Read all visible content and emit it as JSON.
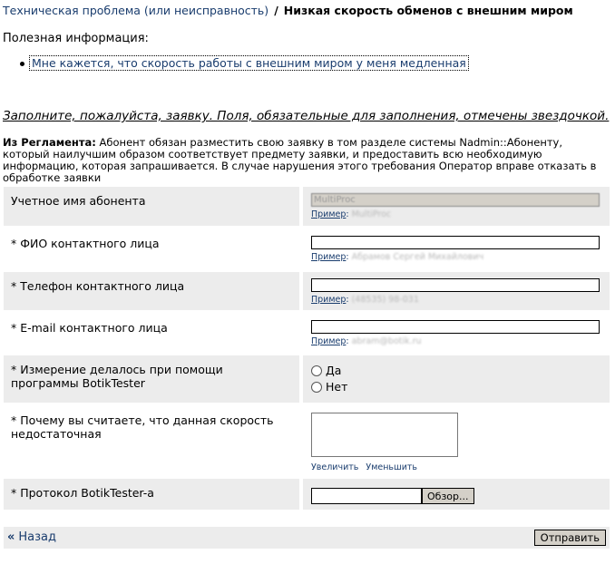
{
  "breadcrumb": {
    "parent": "Техническая проблема (или неисправность)",
    "separator": "/",
    "current": "Низкая скорость обменов с внешним миром"
  },
  "useful": {
    "heading": "Полезная информация:",
    "link": "Мне кажется, что скорость работы с внешним миром у меня медленная"
  },
  "request_note": "Заполните, пожалуйста, заявку. Поля, обязательные для заполнения, отмечены звездочкой.",
  "reglament": {
    "label": "Из Регламента:",
    "text": " Абонент обязан разместить свою заявку в том разделе системы Nadmin::Абоненту, который наилучшим образом соответствует предмету заявки, и предоставить всю необходимую информацию, которая запрашивается. В случае нарушения этого требования Оператор вправе отказать в обработке заявки"
  },
  "form": {
    "example_label": "Пример",
    "account": {
      "label": "Учетное имя абонента",
      "value": "MultiProc",
      "example": "MultiProc"
    },
    "fio": {
      "label": "* ФИО контактного лица",
      "value": "",
      "example": "Абрамов Сергей Михайлович"
    },
    "phone": {
      "label": "* Телефон контактного лица",
      "value": "",
      "example": "(48535) 98-031"
    },
    "email": {
      "label": "* E-mail контактного лица",
      "value": "",
      "example": "abram@botik.ru"
    },
    "botiktester": {
      "label": "* Измерение делалось при помощи программы BotikTester",
      "options": [
        "Да",
        "Нет"
      ]
    },
    "reason": {
      "label": "* Почему вы считаете, что данная скорость недостаточная",
      "value": "",
      "enlarge": "Увеличить",
      "shrink": "Уменьшить"
    },
    "protocol": {
      "label": "* Протокол BotikTester-a",
      "browse": "Обзор..."
    }
  },
  "footer": {
    "back": "Назад",
    "submit": "Отправить"
  }
}
